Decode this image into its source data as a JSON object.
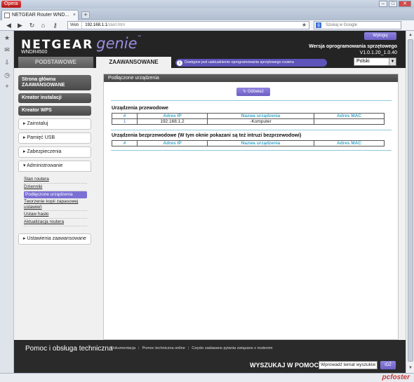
{
  "browser": {
    "menu_label": "Opera",
    "tab_title": "NETGEAR Router WND...",
    "address_badge": "Web",
    "address_host": "192.168.1.1",
    "address_path": "/start.htm",
    "search_placeholder": "Szukaj w Google",
    "window_controls": [
      "–",
      "□",
      "✕"
    ],
    "watermark": "pcfoster"
  },
  "router": {
    "brand": "NETGEAR",
    "product": "genie",
    "model": "WNDR4500",
    "logout_label": "Wyloguj",
    "firmware_label": "Wersja oprogramowania sprzętowego",
    "firmware_value": "V1.0.1.20_1.0.40",
    "tab_basic": "PODSTAWOWE",
    "tab_advanced": "ZAAWANSOWANE",
    "update_notice": "Dostępne jest uaktualnienie oprogramowania sprzętowego routera",
    "language": "Polski"
  },
  "sidebar": {
    "home": "Strona główna ZAAWANSOWANE",
    "setup_wizard": "Kreator instalacji",
    "wps_wizard": "Kreator WPS",
    "sections": [
      {
        "label": "Zainstaluj"
      },
      {
        "label": "Pamięć USB"
      },
      {
        "label": "Zabezpieczenia"
      },
      {
        "label": "Administrowanie"
      }
    ],
    "admin_items": [
      {
        "label": "Stan routera"
      },
      {
        "label": "Dzienniki"
      },
      {
        "label": "Podłączone urządzenia"
      },
      {
        "label": "Tworzenie kopii zapasowej ustawień"
      },
      {
        "label": "Ustaw hasło"
      },
      {
        "label": "Aktualizacja routera"
      }
    ],
    "advanced_settings": "Ustawienia zaawansowane"
  },
  "content": {
    "title": "Podłączone urządzenia",
    "refresh_label": "Odśwież",
    "wired_title": "Urządzenia przewodowe",
    "wireless_title": "Urządzenia bezprzewodowe (W tym oknie pokazani są też intruzi bezprzewodowi)",
    "columns": [
      "#",
      "Adres IP",
      "Nazwa urządzenia",
      "Adres MAC"
    ],
    "wired_rows": [
      {
        "num": "1",
        "ip": "192.168.1.2",
        "name": "-Komputer",
        "mac": ""
      }
    ]
  },
  "footer": {
    "help_title": "Pomoc i obsługa techniczna",
    "links": [
      "Dokumentacja",
      "Pomoc techniczna online",
      "Często zadawane pytania związane z routerem"
    ],
    "search_label": "WYSZUKAJ W POMOCY",
    "search_value": "Wprowadź temat wyszukiw",
    "search_button": "IDŹ"
  }
}
